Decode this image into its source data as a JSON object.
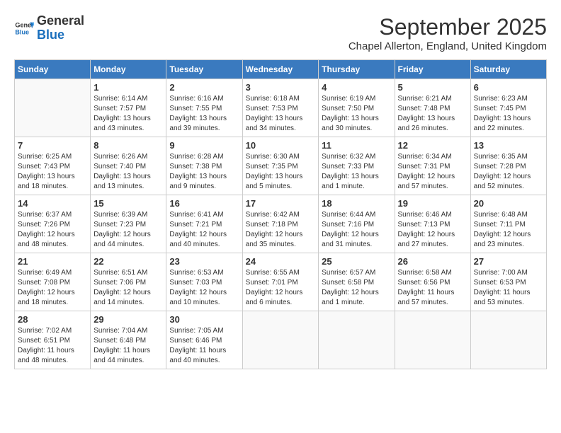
{
  "header": {
    "logo_general": "General",
    "logo_blue": "Blue",
    "month_title": "September 2025",
    "location": "Chapel Allerton, England, United Kingdom"
  },
  "days_of_week": [
    "Sunday",
    "Monday",
    "Tuesday",
    "Wednesday",
    "Thursday",
    "Friday",
    "Saturday"
  ],
  "weeks": [
    [
      {
        "day": "",
        "info": ""
      },
      {
        "day": "1",
        "info": "Sunrise: 6:14 AM\nSunset: 7:57 PM\nDaylight: 13 hours\nand 43 minutes."
      },
      {
        "day": "2",
        "info": "Sunrise: 6:16 AM\nSunset: 7:55 PM\nDaylight: 13 hours\nand 39 minutes."
      },
      {
        "day": "3",
        "info": "Sunrise: 6:18 AM\nSunset: 7:53 PM\nDaylight: 13 hours\nand 34 minutes."
      },
      {
        "day": "4",
        "info": "Sunrise: 6:19 AM\nSunset: 7:50 PM\nDaylight: 13 hours\nand 30 minutes."
      },
      {
        "day": "5",
        "info": "Sunrise: 6:21 AM\nSunset: 7:48 PM\nDaylight: 13 hours\nand 26 minutes."
      },
      {
        "day": "6",
        "info": "Sunrise: 6:23 AM\nSunset: 7:45 PM\nDaylight: 13 hours\nand 22 minutes."
      }
    ],
    [
      {
        "day": "7",
        "info": "Sunrise: 6:25 AM\nSunset: 7:43 PM\nDaylight: 13 hours\nand 18 minutes."
      },
      {
        "day": "8",
        "info": "Sunrise: 6:26 AM\nSunset: 7:40 PM\nDaylight: 13 hours\nand 13 minutes."
      },
      {
        "day": "9",
        "info": "Sunrise: 6:28 AM\nSunset: 7:38 PM\nDaylight: 13 hours\nand 9 minutes."
      },
      {
        "day": "10",
        "info": "Sunrise: 6:30 AM\nSunset: 7:35 PM\nDaylight: 13 hours\nand 5 minutes."
      },
      {
        "day": "11",
        "info": "Sunrise: 6:32 AM\nSunset: 7:33 PM\nDaylight: 13 hours\nand 1 minute."
      },
      {
        "day": "12",
        "info": "Sunrise: 6:34 AM\nSunset: 7:31 PM\nDaylight: 12 hours\nand 57 minutes."
      },
      {
        "day": "13",
        "info": "Sunrise: 6:35 AM\nSunset: 7:28 PM\nDaylight: 12 hours\nand 52 minutes."
      }
    ],
    [
      {
        "day": "14",
        "info": "Sunrise: 6:37 AM\nSunset: 7:26 PM\nDaylight: 12 hours\nand 48 minutes."
      },
      {
        "day": "15",
        "info": "Sunrise: 6:39 AM\nSunset: 7:23 PM\nDaylight: 12 hours\nand 44 minutes."
      },
      {
        "day": "16",
        "info": "Sunrise: 6:41 AM\nSunset: 7:21 PM\nDaylight: 12 hours\nand 40 minutes."
      },
      {
        "day": "17",
        "info": "Sunrise: 6:42 AM\nSunset: 7:18 PM\nDaylight: 12 hours\nand 35 minutes."
      },
      {
        "day": "18",
        "info": "Sunrise: 6:44 AM\nSunset: 7:16 PM\nDaylight: 12 hours\nand 31 minutes."
      },
      {
        "day": "19",
        "info": "Sunrise: 6:46 AM\nSunset: 7:13 PM\nDaylight: 12 hours\nand 27 minutes."
      },
      {
        "day": "20",
        "info": "Sunrise: 6:48 AM\nSunset: 7:11 PM\nDaylight: 12 hours\nand 23 minutes."
      }
    ],
    [
      {
        "day": "21",
        "info": "Sunrise: 6:49 AM\nSunset: 7:08 PM\nDaylight: 12 hours\nand 18 minutes."
      },
      {
        "day": "22",
        "info": "Sunrise: 6:51 AM\nSunset: 7:06 PM\nDaylight: 12 hours\nand 14 minutes."
      },
      {
        "day": "23",
        "info": "Sunrise: 6:53 AM\nSunset: 7:03 PM\nDaylight: 12 hours\nand 10 minutes."
      },
      {
        "day": "24",
        "info": "Sunrise: 6:55 AM\nSunset: 7:01 PM\nDaylight: 12 hours\nand 6 minutes."
      },
      {
        "day": "25",
        "info": "Sunrise: 6:57 AM\nSunset: 6:58 PM\nDaylight: 12 hours\nand 1 minute."
      },
      {
        "day": "26",
        "info": "Sunrise: 6:58 AM\nSunset: 6:56 PM\nDaylight: 11 hours\nand 57 minutes."
      },
      {
        "day": "27",
        "info": "Sunrise: 7:00 AM\nSunset: 6:53 PM\nDaylight: 11 hours\nand 53 minutes."
      }
    ],
    [
      {
        "day": "28",
        "info": "Sunrise: 7:02 AM\nSunset: 6:51 PM\nDaylight: 11 hours\nand 48 minutes."
      },
      {
        "day": "29",
        "info": "Sunrise: 7:04 AM\nSunset: 6:48 PM\nDaylight: 11 hours\nand 44 minutes."
      },
      {
        "day": "30",
        "info": "Sunrise: 7:05 AM\nSunset: 6:46 PM\nDaylight: 11 hours\nand 40 minutes."
      },
      {
        "day": "",
        "info": ""
      },
      {
        "day": "",
        "info": ""
      },
      {
        "day": "",
        "info": ""
      },
      {
        "day": "",
        "info": ""
      }
    ]
  ]
}
